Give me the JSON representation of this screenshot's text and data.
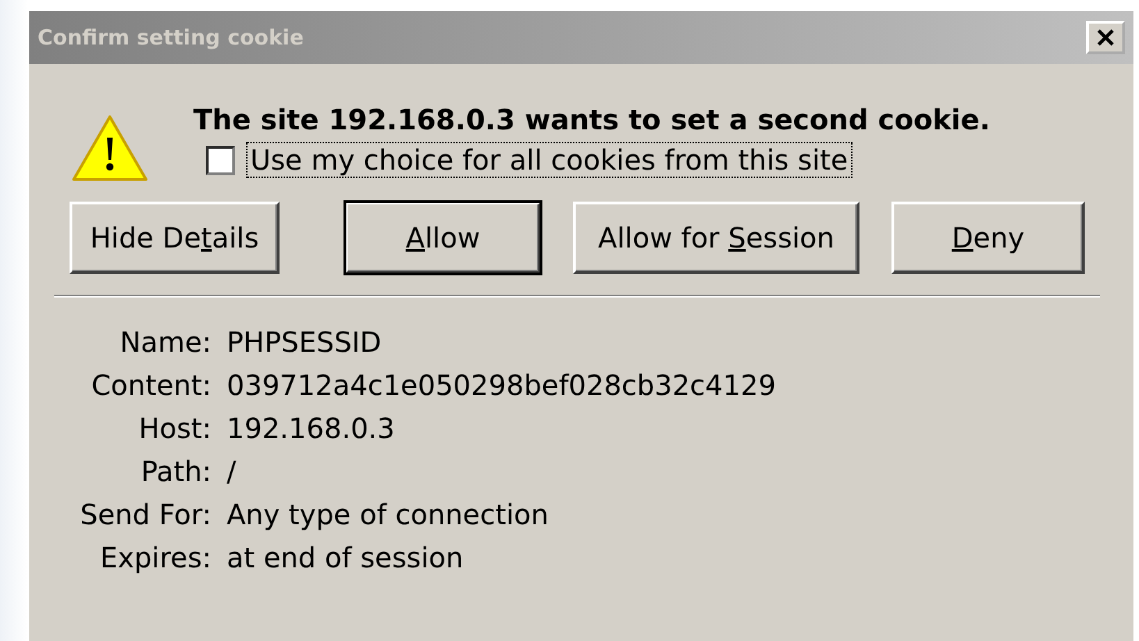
{
  "window": {
    "title": "Confirm setting cookie",
    "active": false
  },
  "message": "The site 192.168.0.3 wants to set a second cookie.",
  "remember_choice": {
    "label": "Use my choice for all cookies from this site",
    "checked": false,
    "focused": true
  },
  "buttons": [
    {
      "before": "Hide De",
      "key": "t",
      "after": "ails",
      "default": false
    },
    {
      "key": "A",
      "after": "llow",
      "default": true
    },
    {
      "before": "Allow for ",
      "key": "S",
      "after": "ession",
      "default": false
    },
    {
      "key": "D",
      "after": "eny",
      "default": false
    }
  ],
  "details": [
    {
      "label": "Name:",
      "value": "PHPSESSID"
    },
    {
      "label": "Content:",
      "value": "039712a4c1e050298bef028cb32c4129"
    },
    {
      "label": "Host:",
      "value": "192.168.0.3"
    },
    {
      "label": "Path:",
      "value": "/"
    },
    {
      "label": "Send For:",
      "value": "Any type of connection"
    },
    {
      "label": "Expires:",
      "value": "at end of session"
    }
  ]
}
